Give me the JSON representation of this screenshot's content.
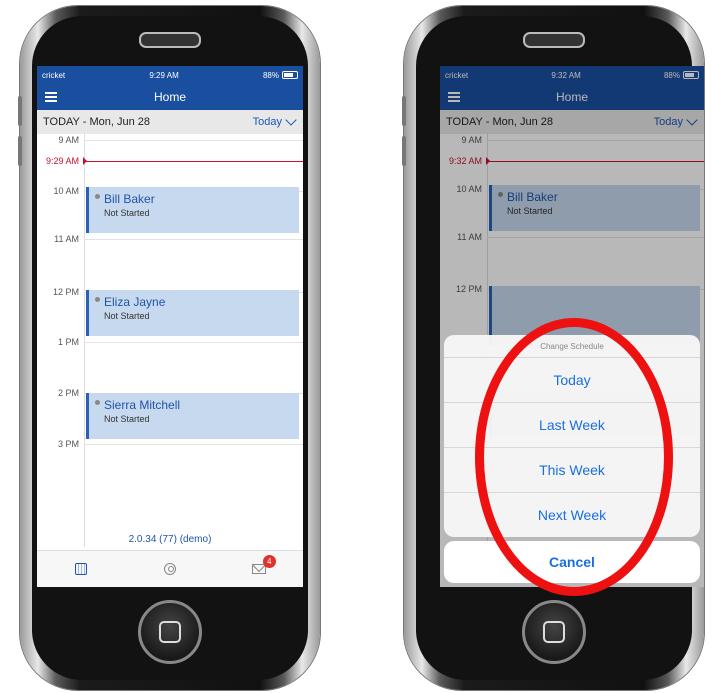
{
  "left_phone": {
    "status": {
      "carrier": "cricket",
      "time": "9:29 AM",
      "battery": "88%"
    },
    "nav": {
      "title": "Home"
    },
    "date_bar": {
      "label": "TODAY - Mon, Jun 28",
      "selector": "Today"
    },
    "hours": [
      "9 AM",
      "10 AM",
      "11 AM",
      "12 PM",
      "1 PM",
      "2 PM",
      "3 PM"
    ],
    "now_label": "9:29 AM",
    "appointments": [
      {
        "name": "Bill Baker",
        "status": "Not Started"
      },
      {
        "name": "Eliza Jayne",
        "status": "Not Started"
      },
      {
        "name": "Sierra Mitchell",
        "status": "Not Started"
      }
    ],
    "version": "2.0.34 (77) (demo)",
    "tabs": {
      "calendar_icon": "calendar-icon",
      "profile_icon": "person-icon",
      "messages_icon": "mail-icon",
      "messages_badge": "4"
    }
  },
  "right_phone": {
    "status": {
      "carrier": "cricket",
      "time": "9:32 AM",
      "battery": "88%"
    },
    "nav": {
      "title": "Home"
    },
    "date_bar": {
      "label": "TODAY - Mon, Jun 28",
      "selector": "Today"
    },
    "hours": [
      "9 AM",
      "10 AM",
      "11 AM",
      "12 PM"
    ],
    "now_label": "9:32 AM",
    "appointments": [
      {
        "name": "Bill Baker",
        "status": "Not Started"
      }
    ],
    "action_sheet": {
      "title": "Change Schedule",
      "options": [
        "Today",
        "Last Week",
        "This Week",
        "Next Week"
      ],
      "cancel": "Cancel"
    },
    "highlight_color": "#ee1111"
  }
}
